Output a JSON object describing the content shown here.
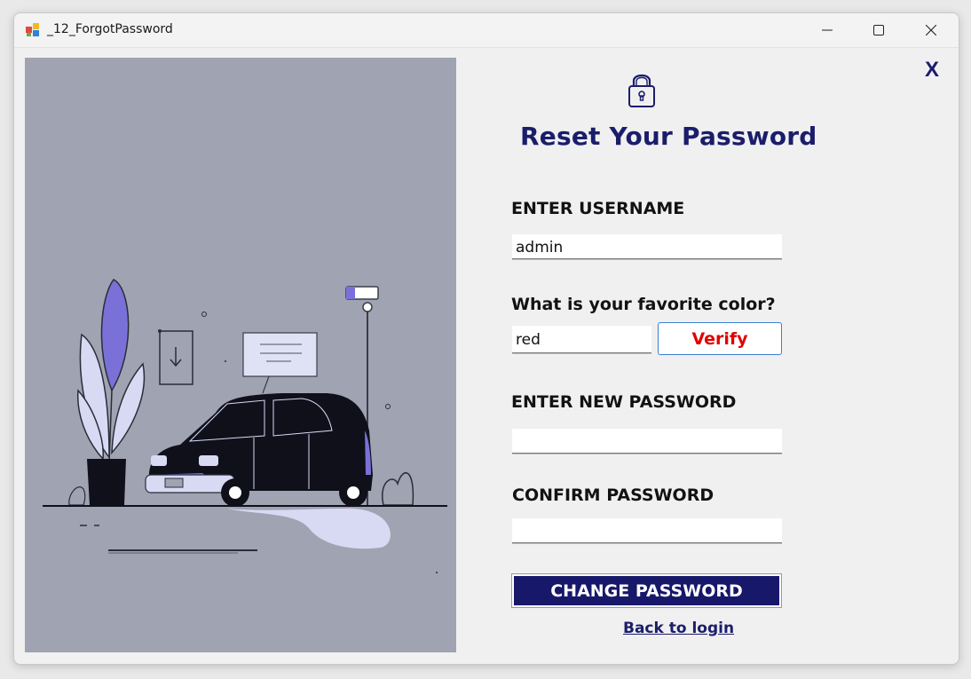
{
  "window": {
    "title": "_12_ForgotPassword",
    "icon": "app-icon",
    "controls": [
      "minimize-icon",
      "maximize-icon",
      "close-icon"
    ]
  },
  "form": {
    "close_label": "X",
    "lock_icon": "lock-icon",
    "heading": "Reset Your Password",
    "username_label": "ENTER USERNAME",
    "username_value": "admin",
    "question_label": "What is your favorite color?",
    "answer_value": "red",
    "verify_label": "Verify",
    "new_password_label": "ENTER NEW PASSWORD",
    "new_password_value": "",
    "confirm_password_label": "CONFIRM PASSWORD",
    "confirm_password_value": "",
    "change_button_label": "CHANGE PASSWORD",
    "back_link_label": "Back to login"
  },
  "illustration": {
    "description_icon": "car-parking-illustration",
    "colors": {
      "background": "#a0a3b1",
      "accent": "#7a71d8",
      "light": "#d8daf4",
      "dark": "#0f101a"
    }
  },
  "theme": {
    "primary": "#17186a",
    "verify_text": "#e00000",
    "verify_border": "#3b7fd4"
  }
}
